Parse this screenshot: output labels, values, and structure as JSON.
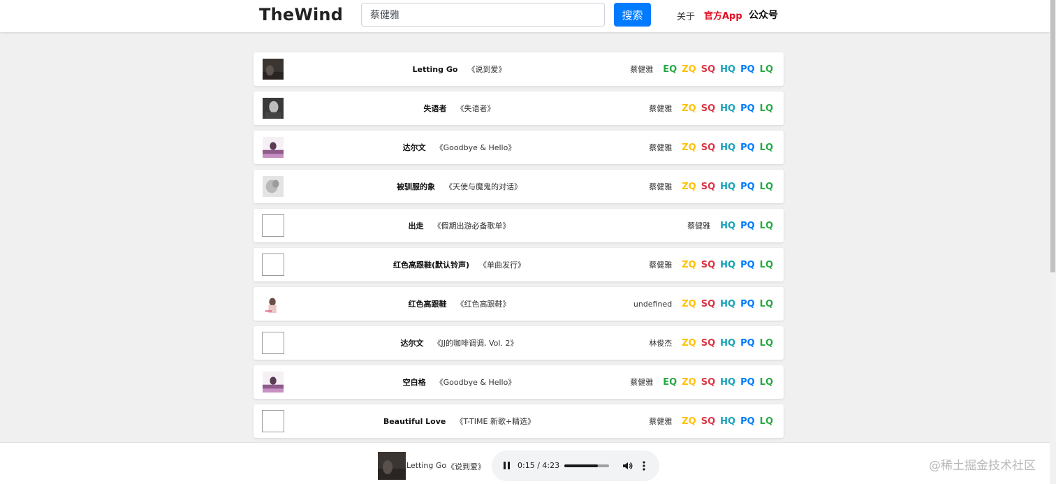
{
  "header": {
    "logo": "TheWind",
    "search_value": "蔡健雅",
    "search_button": "搜索",
    "nav": {
      "about": "关于",
      "app": "官方App",
      "wechat": "公众号"
    }
  },
  "quality_colors": {
    "EQ": "#28a745",
    "ZQ": "#ffc107",
    "SQ": "#dc3545",
    "HQ": "#17a2b8",
    "PQ": "#007bff",
    "LQ": "#28a745"
  },
  "songs": [
    {
      "name": "Letting Go",
      "album": "《说到爱》",
      "artist": "蔡健雅",
      "qualities": [
        "EQ",
        "ZQ",
        "SQ",
        "HQ",
        "PQ",
        "LQ"
      ],
      "cover": "dark"
    },
    {
      "name": "失语者",
      "album": "《失语者》",
      "artist": "蔡健雅",
      "qualities": [
        "ZQ",
        "SQ",
        "HQ",
        "PQ",
        "LQ"
      ],
      "cover": "portrait"
    },
    {
      "name": "达尔文",
      "album": "《Goodbye & Hello》",
      "artist": "蔡健雅",
      "qualities": [
        "ZQ",
        "SQ",
        "HQ",
        "PQ",
        "LQ"
      ],
      "cover": "purple"
    },
    {
      "name": "被驯服的象",
      "album": "《天使与魔鬼的对话》",
      "artist": "蔡健雅",
      "qualities": [
        "ZQ",
        "SQ",
        "HQ",
        "PQ",
        "LQ"
      ],
      "cover": "grey"
    },
    {
      "name": "出走",
      "album": "《假期出游必备歌单》",
      "artist": "蔡健雅",
      "qualities": [
        "HQ",
        "PQ",
        "LQ"
      ],
      "cover": "none"
    },
    {
      "name": "红色高跟鞋(默认铃声)",
      "album": "《单曲发行》",
      "artist": "蔡健雅",
      "qualities": [
        "ZQ",
        "SQ",
        "HQ",
        "PQ",
        "LQ"
      ],
      "cover": "none"
    },
    {
      "name": "红色高跟鞋",
      "album": "《红色高跟鞋》",
      "artist": "undefined",
      "qualities": [
        "ZQ",
        "SQ",
        "HQ",
        "PQ",
        "LQ"
      ],
      "cover": "light"
    },
    {
      "name": "达尔文",
      "album": "《JJ的咖啡调调, Vol. 2》",
      "artist": "林俊杰",
      "qualities": [
        "ZQ",
        "SQ",
        "HQ",
        "PQ",
        "LQ"
      ],
      "cover": "none"
    },
    {
      "name": "空白格",
      "album": "《Goodbye & Hello》",
      "artist": "蔡健雅",
      "qualities": [
        "EQ",
        "ZQ",
        "SQ",
        "HQ",
        "PQ",
        "LQ"
      ],
      "cover": "purple"
    },
    {
      "name": "Beautiful Love",
      "album": "《T-TIME 新歌+精选》",
      "artist": "蔡健雅",
      "qualities": [
        "ZQ",
        "SQ",
        "HQ",
        "PQ",
        "LQ"
      ],
      "cover": "none"
    }
  ],
  "player": {
    "title": "Letting Go",
    "album": "《说到爱》",
    "time": "0:15 / 4:23",
    "progress_fraction": 0.75
  },
  "watermark": "@稀土掘金技术社区"
}
